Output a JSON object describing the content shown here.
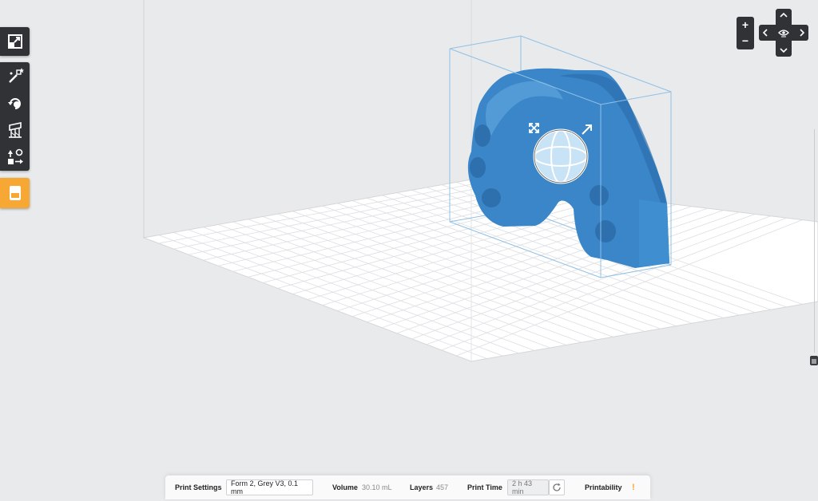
{
  "toolbar": {
    "groups": [
      {
        "name": "view",
        "tools": [
          "expand-icon"
        ]
      },
      {
        "name": "edit",
        "tools": [
          "magic-wand-icon",
          "rotate-icon",
          "supports-icon",
          "layout-icon"
        ]
      },
      {
        "name": "job",
        "tools": [
          "printer-icon"
        ]
      }
    ],
    "accent_color": "#f7a733"
  },
  "view_controls": {
    "zoom_in_label": "+",
    "zoom_out_label": "−"
  },
  "status_bar": {
    "print_settings_label": "Print Settings",
    "print_settings_value": "Form 2, Grey V3, 0.1 mm",
    "volume_label": "Volume",
    "volume_value": "30.10 mL",
    "layers_label": "Layers",
    "layers_value": "457",
    "print_time_label": "Print Time",
    "print_time_value": "2 h 43 min",
    "printability_label": "Printability",
    "printability_status": "!",
    "printability_color": "#f7a733"
  },
  "scene": {
    "model_color": "#3a86c8",
    "grid_color": "#d8dadd",
    "build_volume_color": "#7fb4dd"
  }
}
